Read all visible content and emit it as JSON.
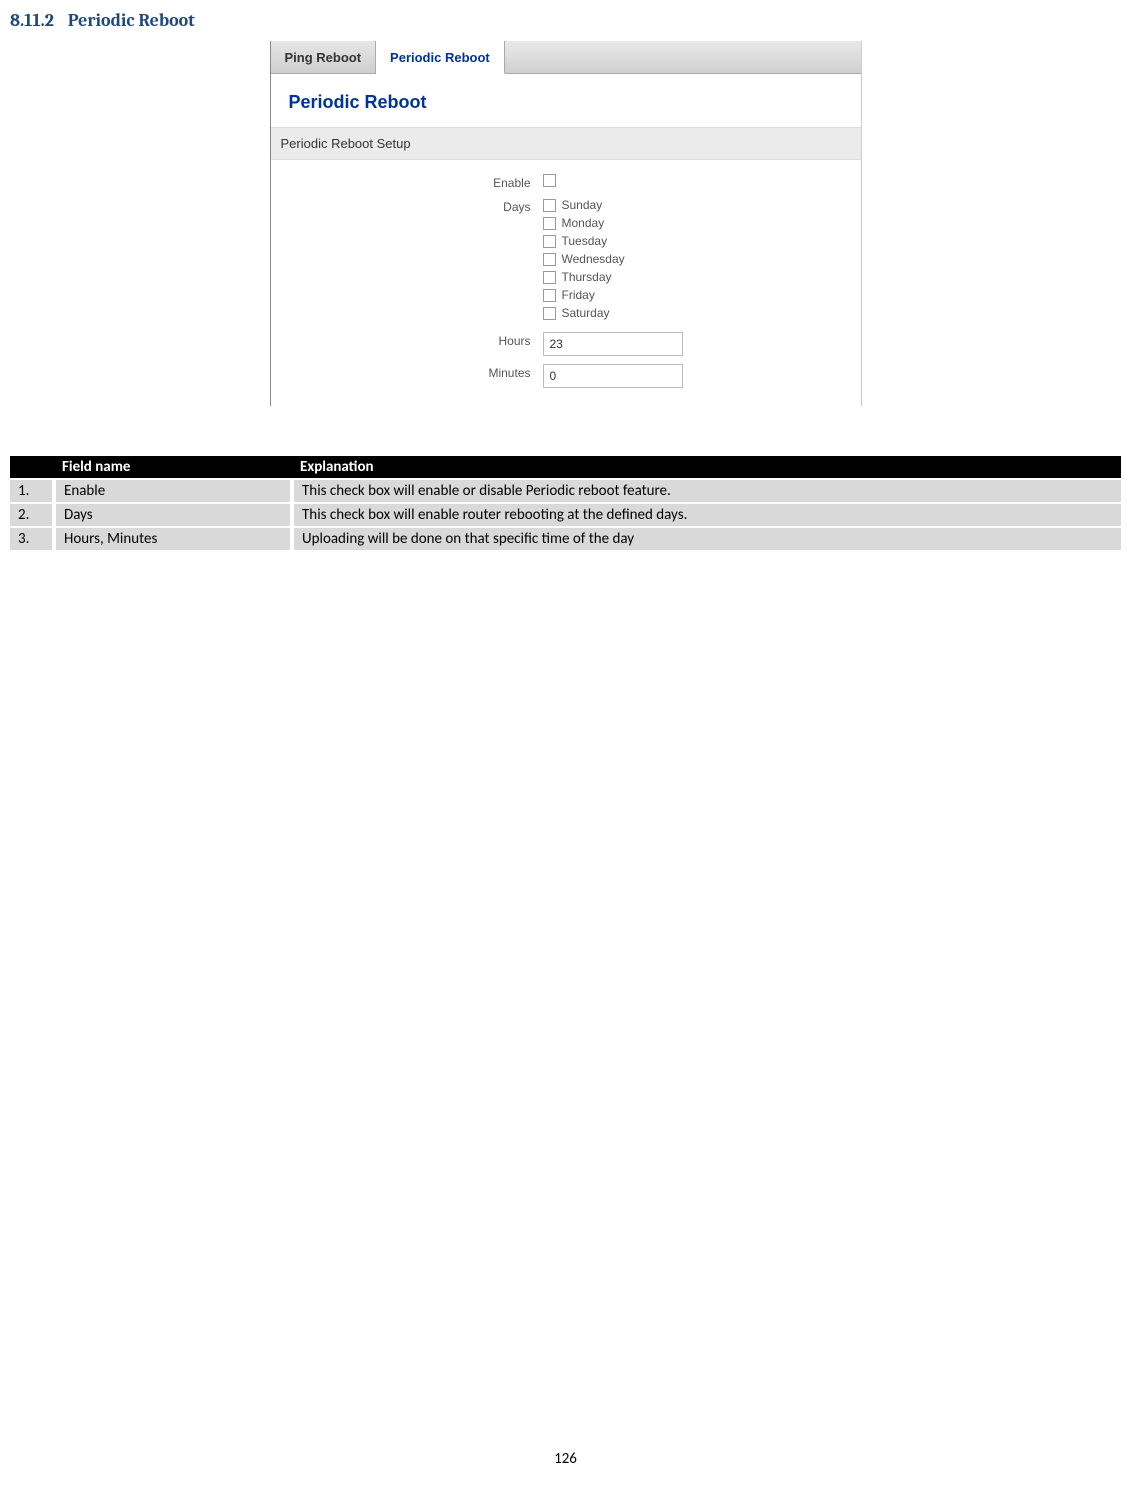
{
  "heading": {
    "number": "8.11.2",
    "title": "Periodic Reboot"
  },
  "ui": {
    "tabs": [
      {
        "label": "Ping Reboot",
        "active": false
      },
      {
        "label": "Periodic Reboot",
        "active": true
      }
    ],
    "section_title": "Periodic Reboot",
    "subsection": "Periodic Reboot Setup",
    "labels": {
      "enable": "Enable",
      "days": "Days",
      "hours": "Hours",
      "minutes": "Minutes"
    },
    "days": [
      "Sunday",
      "Monday",
      "Tuesday",
      "Wednesday",
      "Thursday",
      "Friday",
      "Saturday"
    ],
    "values": {
      "hours": "23",
      "minutes": "0"
    }
  },
  "table": {
    "headers": [
      "",
      "Field name",
      "Explanation"
    ],
    "rows": [
      {
        "num": "1.",
        "name": "Enable",
        "expl": "This check box will enable or disable Periodic reboot feature."
      },
      {
        "num": "2.",
        "name": "Days",
        "expl": "This check box will enable router rebooting at the defined days."
      },
      {
        "num": "3.",
        "name": "Hours, Minutes",
        "expl": "Uploading will be done on that specific time of the day"
      }
    ]
  },
  "page_number": "126"
}
